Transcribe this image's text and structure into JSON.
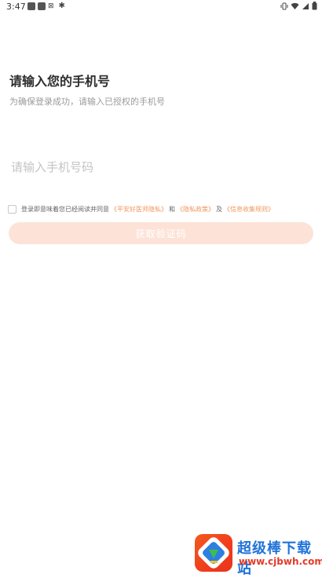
{
  "status_bar": {
    "time": "3:47",
    "icons": [
      "notification-square-icon",
      "notification-square-icon",
      "x-icon",
      "bug-icon",
      "vibrate-icon",
      "wifi-icon",
      "signal-icon",
      "battery-icon"
    ]
  },
  "login": {
    "title": "请输入您的手机号",
    "subtitle": "为确保登录成功，请输入已授权的手机号",
    "phone_placeholder": "请输入手机号码",
    "phone_value": ""
  },
  "agreement": {
    "prefix": "登录即意味着您已经阅读并同意",
    "link_privacy": "《平安好医师隐私》",
    "and1": "和",
    "link_policy": "《隐私政策》",
    "and2": "及",
    "link_info": "《信息收集规则》"
  },
  "button": {
    "get_code_label": "获取验证码"
  },
  "watermark": {
    "title": "超级棒下载站",
    "url": "www.cjbwh.com"
  },
  "colors": {
    "link": "#f0975d",
    "button_bg": "#fde3d7",
    "watermark_blue": "#2173d8",
    "watermark_red": "#e23b2a"
  }
}
